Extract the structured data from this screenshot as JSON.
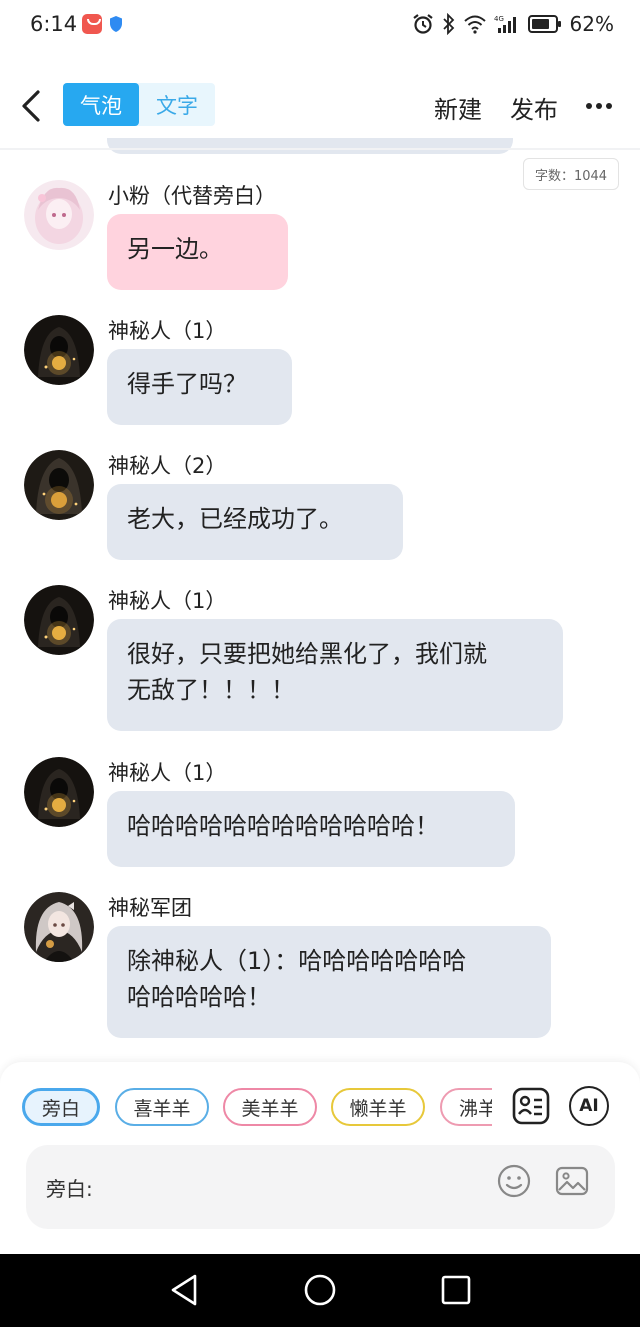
{
  "status_bar": {
    "time": "6:14",
    "battery_percent": "62%"
  },
  "top_nav": {
    "tabs": [
      {
        "label": "气泡",
        "active": true
      },
      {
        "label": "文字",
        "active": false
      }
    ],
    "new_label": "新建",
    "publish_label": "发布"
  },
  "word_count": "字数：1044",
  "messages": [
    {
      "sender": "小粉（代替旁白）",
      "text": "另一边。",
      "style": "pink",
      "avatar": "pink-hair-girl"
    },
    {
      "sender": "神秘人（1）",
      "text": "得手了吗？",
      "style": "gray",
      "avatar": "hooded-figure"
    },
    {
      "sender": "神秘人（2）",
      "text": "老大，已经成功了。",
      "style": "gray",
      "avatar": "hooded-figure-2"
    },
    {
      "sender": "神秘人（1）",
      "text": "很好，只要把她给黑化了，我们就无敌了！！！！",
      "style": "gray",
      "avatar": "hooded-figure"
    },
    {
      "sender": "神秘人（1）",
      "text": "哈哈哈哈哈哈哈哈哈哈哈哈！",
      "style": "gray",
      "avatar": "hooded-figure"
    },
    {
      "sender": "神秘军团",
      "text": "除神秘人（1）：哈哈哈哈哈哈哈哈哈哈哈！",
      "style": "gray",
      "avatar": "dark-dress-girl"
    }
  ],
  "message_lines": {
    "m4": [
      "很好，只要把她给黑化了，我们就",
      "无敌了！！！！"
    ],
    "m6": [
      "除神秘人（1）：哈哈哈哈哈哈哈",
      "哈哈哈哈哈！"
    ]
  },
  "characters": [
    {
      "label": "旁白",
      "selected": true,
      "color": "#4aa8ec"
    },
    {
      "label": "喜羊羊",
      "selected": false,
      "color": "#5aaee6"
    },
    {
      "label": "美羊羊",
      "selected": false,
      "color": "#ee88a6"
    },
    {
      "label": "懒羊羊",
      "selected": false,
      "color": "#e7c83a"
    },
    {
      "label": "沸羊羊",
      "selected": false,
      "color": "#ee9bb1"
    }
  ],
  "tools": {
    "card_icon": "contact-card-icon",
    "ai_label": "AI"
  },
  "input": {
    "label": "旁白:"
  },
  "colors": {
    "accent": "#27a8f0",
    "bubble_gray": "#e2e7ef",
    "bubble_pink": "#ffd3de"
  }
}
